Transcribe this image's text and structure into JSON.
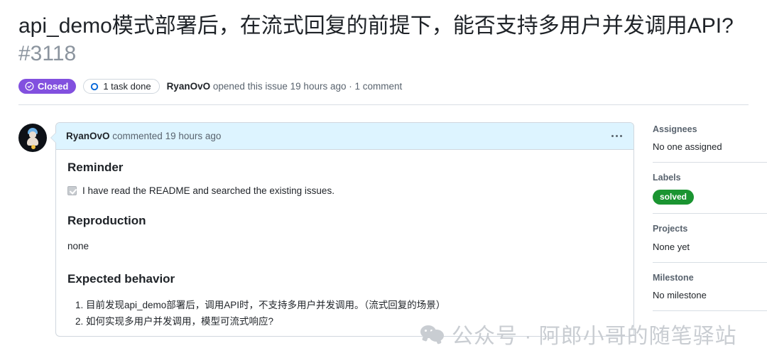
{
  "issue": {
    "title": "api_demo模式部署后，在流式回复的前提下，能否支持多用户并发调用API?",
    "number": "#3118",
    "state_label": "Closed",
    "tasks_label": "1 task done",
    "meta_author": "RyanOvO",
    "meta_rest": " opened this issue 19 hours ago · 1 comment"
  },
  "comment": {
    "author": "RyanOvO",
    "meta": " commented 19 hours ago",
    "sections": {
      "reminder_heading": "Reminder",
      "reminder_checkbox_label": "I have read the README and searched the existing issues.",
      "reproduction_heading": "Reproduction",
      "reproduction_text": "none",
      "expected_heading": "Expected behavior",
      "expected_item_1": "目前发现api_demo部署后，调用API时，不支持多用户并发调用。（流式回复的场景）",
      "expected_item_2": "如何实现多用户并发调用，模型可流式响应?"
    }
  },
  "sidebar": {
    "assignees_title": "Assignees",
    "assignees_value": "No one assigned",
    "labels_title": "Labels",
    "labels_value": "solved",
    "projects_title": "Projects",
    "projects_value": "None yet",
    "milestone_title": "Milestone",
    "milestone_value": "No milestone"
  },
  "watermark": {
    "text": "公众号 · 阿郎小哥的随笔驿站"
  },
  "colors": {
    "closed_purple": "#8250df",
    "label_green": "#1a9431",
    "comment_head_blue": "#ddf4ff",
    "border_gray": "#d0d7de",
    "muted_text": "#59636e"
  }
}
